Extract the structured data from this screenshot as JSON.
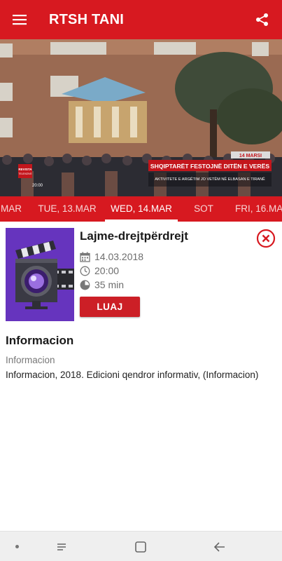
{
  "app": {
    "title": "RTSH TANI",
    "accent_color": "#d71920",
    "menu_icon": "hamburger-menu-icon",
    "share_icon": "share-icon"
  },
  "video": {
    "news_ticker": {
      "date_tag": "14 MARSI",
      "headline": "SHQIPTARËT FESTOJNË DITËN E VERËS",
      "subline": "AKTIVITETE E ARGËTIM JO VETËM NË ELBASAN E TIRANË",
      "channel_logo": "REVISTA",
      "channel_logo_sub": "TELEVIZIVE",
      "clock": "20:00"
    }
  },
  "dates": [
    {
      "label": "MAR",
      "active": false
    },
    {
      "label": "TUE, 13.MAR",
      "active": false
    },
    {
      "label": "WED, 14.MAR",
      "active": true
    },
    {
      "label": "SOT",
      "active": false
    },
    {
      "label": "FRI, 16.MAR",
      "active": false
    }
  ],
  "program": {
    "title": "Lajme-drejtpërdrejt",
    "date": "14.03.2018",
    "time": "20:00",
    "duration": "35 min",
    "play_label": "LUAJ",
    "thumbnail_icon": "clapperboard-camera-icon",
    "close_icon": "close-circle-icon"
  },
  "info": {
    "title": "Informacion",
    "category": "Informacion",
    "description": "Informacion, 2018. Edicioni qendror informativ, (Informacion)"
  },
  "navbar": {
    "dot_icon": "dot-icon",
    "recents_icon": "recents-icon",
    "home_icon": "home-icon",
    "back_icon": "back-arrow-icon"
  }
}
